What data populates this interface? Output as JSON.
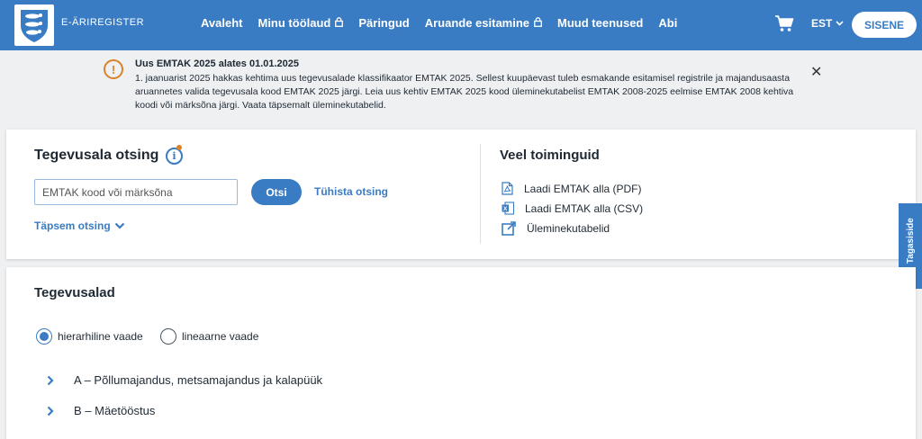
{
  "header": {
    "brand": "E-ÄRIREGISTER",
    "nav": [
      {
        "label": "Avaleht",
        "locked": false
      },
      {
        "label": "Minu töölaud",
        "locked": true
      },
      {
        "label": "Päringud",
        "locked": false
      },
      {
        "label": "Aruande esitamine",
        "locked": true
      },
      {
        "label": "Muud teenused",
        "locked": false
      },
      {
        "label": "Abi",
        "locked": false
      }
    ],
    "language": "EST",
    "login_label": "SISENE"
  },
  "notice": {
    "title": "Uus EMTAK 2025 alates 01.01.2025",
    "text": "1. jaanuarist 2025 hakkas kehtima uus tegevusalade klassifikaator EMTAK 2025. Sellest kuupäevast tuleb esmakande esitamisel registrile ja majandusaasta aruannetes valida tegevusala kood EMTAK 2025 järgi. Leia uus kehtiv EMTAK 2025 kood üleminekutabelist EMTAK 2008-2025 eelmise EMTAK 2008 kehtiva koodi või märksõna järgi. Vaata täpsemalt üleminekutabelid."
  },
  "search": {
    "title": "Tegevusala otsing",
    "placeholder": "EMTAK kood või märksõna",
    "search_label": "Otsi",
    "clear_label": "Tühista otsing",
    "advanced_label": "Täpsem otsing"
  },
  "more": {
    "title": "Veel toiminguid",
    "links": [
      {
        "label": "Laadi EMTAK alla (PDF)",
        "icon": "pdf-icon"
      },
      {
        "label": "Laadi EMTAK alla (CSV)",
        "icon": "excel-icon"
      },
      {
        "label": "Üleminekutabelid",
        "icon": "external-link-icon"
      }
    ]
  },
  "feedback_label": "☆ Tagasiside",
  "activities": {
    "title": "Tegevusalad",
    "views": [
      {
        "label": "hierarhiline vaade",
        "selected": true
      },
      {
        "label": "lineaarne vaade",
        "selected": false
      }
    ],
    "items": [
      {
        "label": "A – Põllumajandus, metsamajandus ja kalapüük"
      },
      {
        "label": "B – Mäetööstus"
      }
    ]
  },
  "colors": {
    "primary": "#3a7cc3",
    "warning": "#d9822b"
  }
}
